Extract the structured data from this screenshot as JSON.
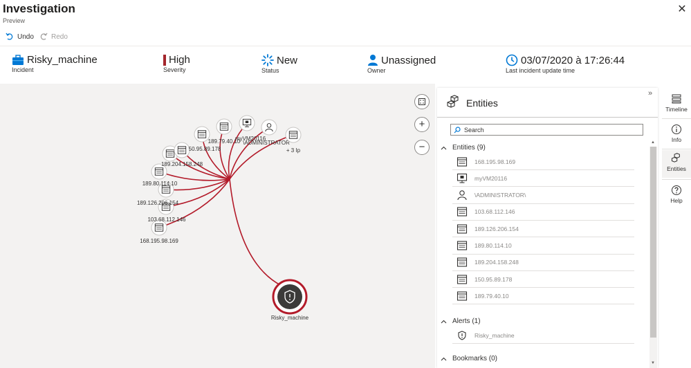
{
  "header": {
    "title": "Investigation",
    "subtitle": "Preview",
    "close_icon": "✕"
  },
  "toolbar": {
    "undo_label": "Undo",
    "redo_label": "Redo"
  },
  "info": {
    "incident": {
      "value": "Risky_machine",
      "label": "Incident"
    },
    "severity": {
      "value": "High",
      "label": "Severity",
      "color": "#a4262c"
    },
    "status": {
      "value": "New",
      "label": "Status"
    },
    "owner": {
      "value": "Unassigned",
      "label": "Owner"
    },
    "updated": {
      "value": "03/07/2020 à 17:26:44",
      "label": "Last incident update time"
    }
  },
  "graph": {
    "center_label": "Risky_machine",
    "edge_color": "#b31b2a",
    "nodes": [
      {
        "label": "168.195.98.169",
        "icon": "server-icon"
      },
      {
        "label": "103.68.112.146",
        "icon": "server-icon"
      },
      {
        "label": "189.126.206.154",
        "icon": "server-icon"
      },
      {
        "label": "189.80.114.10",
        "icon": "server-icon"
      },
      {
        "label": "189.204.158.248",
        "icon": "server-icon"
      },
      {
        "label": "50.95.89.178",
        "icon": "server-icon"
      },
      {
        "label": "",
        "icon": "server-icon"
      },
      {
        "label": "189.79.40.10",
        "icon": "server-icon"
      },
      {
        "label": "myVM20116",
        "icon": "computer-icon"
      },
      {
        "label": "\\ADMINISTRATOR",
        "icon": "user-icon"
      },
      {
        "label": "+ 3 Ip",
        "icon": "server-icon"
      }
    ]
  },
  "panel": {
    "title": "Entities",
    "search_placeholder": "Search",
    "entities_header": "Entities (9)",
    "entities": [
      {
        "label": "168.195.98.169",
        "icon": "server-icon"
      },
      {
        "label": "myVM20116",
        "icon": "computer-icon"
      },
      {
        "label": "\\ADMINISTRATOR\\",
        "icon": "user-icon"
      },
      {
        "label": "103.68.112.146",
        "icon": "server-icon"
      },
      {
        "label": "189.126.206.154",
        "icon": "server-icon"
      },
      {
        "label": "189.80.114.10",
        "icon": "server-icon"
      },
      {
        "label": "189.204.158.248",
        "icon": "server-icon"
      },
      {
        "label": "150.95.89.178",
        "icon": "server-icon"
      },
      {
        "label": "189.79.40.10",
        "icon": "server-icon"
      }
    ],
    "alerts_header": "Alerts (1)",
    "alerts": [
      {
        "label": "Risky_machine",
        "icon": "shield-alert-icon"
      }
    ],
    "bookmarks_header": "Bookmarks (0)",
    "collapse_icon": "»"
  },
  "rail": [
    {
      "label": "Timeline",
      "icon": "timeline-icon"
    },
    {
      "label": "Info",
      "icon": "info-icon"
    },
    {
      "label": "Entities",
      "icon": "cubes-icon",
      "active": true
    },
    {
      "label": "Help",
      "icon": "help-icon"
    }
  ]
}
